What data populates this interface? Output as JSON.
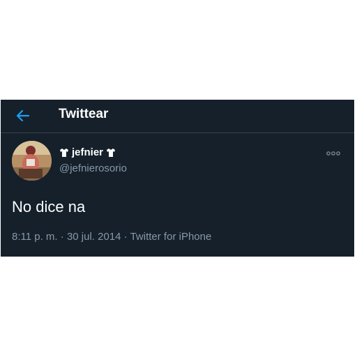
{
  "header": {
    "title": "Twittear",
    "back_icon": "back-arrow-icon"
  },
  "user": {
    "display_name": "jefnier",
    "handle": "@jefnierosorio",
    "avatar_icon": "avatar",
    "badge_icon": "shirt-icon"
  },
  "tweet": {
    "text": "No dice na",
    "time": "8:11 p. m.",
    "separator": "·",
    "date": "30 jul. 2014",
    "source": "Twitter for iPhone"
  },
  "colors": {
    "background": "#15202b",
    "accent": "#1da1f2",
    "secondary_text": "#8899a6",
    "divider": "#38444d"
  }
}
